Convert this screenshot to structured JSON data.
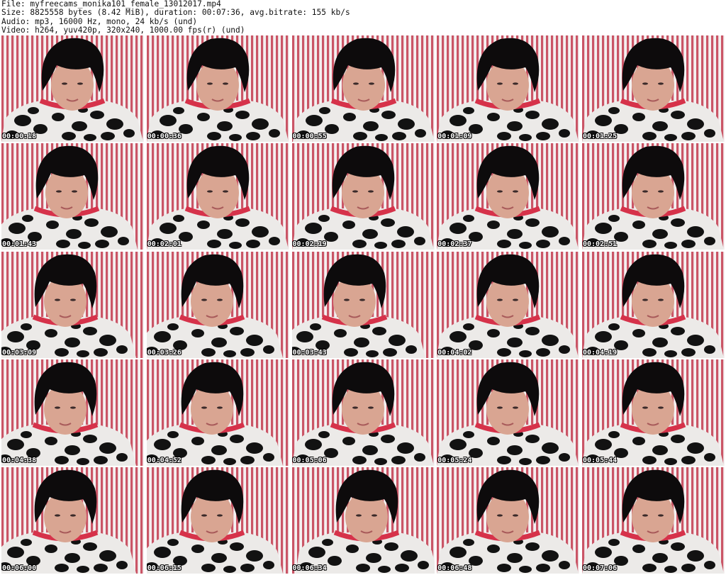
{
  "header": {
    "file_line": "File: myfreecams_monika101_female_13012017.mp4",
    "size_line": "Size: 8825558 bytes (8.42 MiB), duration: 00:07:36, avg.bitrate: 155 kb/s",
    "audio_line": "Audio: mp3, 16000 Hz, mono, 24 kb/s (und)",
    "video_line": "Video: h264, yuv420p, 320x240, 1000.00 fps(r) (und)"
  },
  "colors": {
    "stripe_red": "#c23a4e",
    "stripe_white": "#f4f0f0",
    "hair": "#0d0b0c",
    "skin": "#d9a592",
    "collar": "#d6324a",
    "onesie_white": "#eceae8",
    "onesie_black": "#121212"
  },
  "thumbnails": [
    {
      "time": "00:00:18",
      "offset": 0
    },
    {
      "time": "00:00:36",
      "offset": 0
    },
    {
      "time": "00:00:55",
      "offset": 1
    },
    {
      "time": "00:01:09",
      "offset": 0
    },
    {
      "time": "00:01:25",
      "offset": 0
    },
    {
      "time": "00:01:43",
      "offset": -8
    },
    {
      "time": "00:02:01",
      "offset": 0
    },
    {
      "time": "00:02:19",
      "offset": 0
    },
    {
      "time": "00:02:37",
      "offset": 0
    },
    {
      "time": "00:02:51",
      "offset": 0
    },
    {
      "time": "00:03:09",
      "offset": -10
    },
    {
      "time": "00:03:26",
      "offset": -8
    },
    {
      "time": "00:03:43",
      "offset": -12
    },
    {
      "time": "00:04:02",
      "offset": 0
    },
    {
      "time": "00:04:19",
      "offset": 0
    },
    {
      "time": "00:04:38",
      "offset": -10
    },
    {
      "time": "00:04:52",
      "offset": -8
    },
    {
      "time": "00:05:06",
      "offset": 0
    },
    {
      "time": "00:05:24",
      "offset": 0
    },
    {
      "time": "00:05:44",
      "offset": 0
    },
    {
      "time": "00:06:00",
      "offset": -10
    },
    {
      "time": "00:06:15",
      "offset": -8
    },
    {
      "time": "00:06:34",
      "offset": 5
    },
    {
      "time": "00:06:48",
      "offset": 0
    },
    {
      "time": "00:07:06",
      "offset": 0
    }
  ]
}
